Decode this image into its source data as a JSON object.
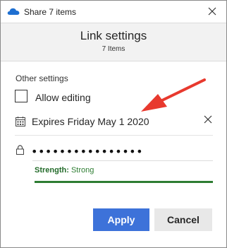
{
  "window": {
    "title": "Share 7 items"
  },
  "header": {
    "title": "Link settings",
    "subtitle": "7 Items"
  },
  "settings": {
    "section_label": "Other settings",
    "allow_editing_label": "Allow editing",
    "allow_editing_checked": false,
    "expiry_text": "Expires Friday May 1 2020",
    "password_masked": "••••••••••••••••",
    "strength_label": "Strength:",
    "strength_value": "Strong"
  },
  "buttons": {
    "apply_label": "Apply",
    "cancel_label": "Cancel"
  },
  "colors": {
    "accent": "#3d72d9",
    "strength": "#2e7d32",
    "annotation_arrow": "#e8392e",
    "header_bg": "#f2f2f2"
  },
  "icons": {
    "app": "onedrive-cloud-icon",
    "close": "close-icon",
    "calendar": "calendar-icon",
    "clear": "clear-icon",
    "lock": "lock-icon",
    "annotation": "red-arrow-annotation"
  }
}
